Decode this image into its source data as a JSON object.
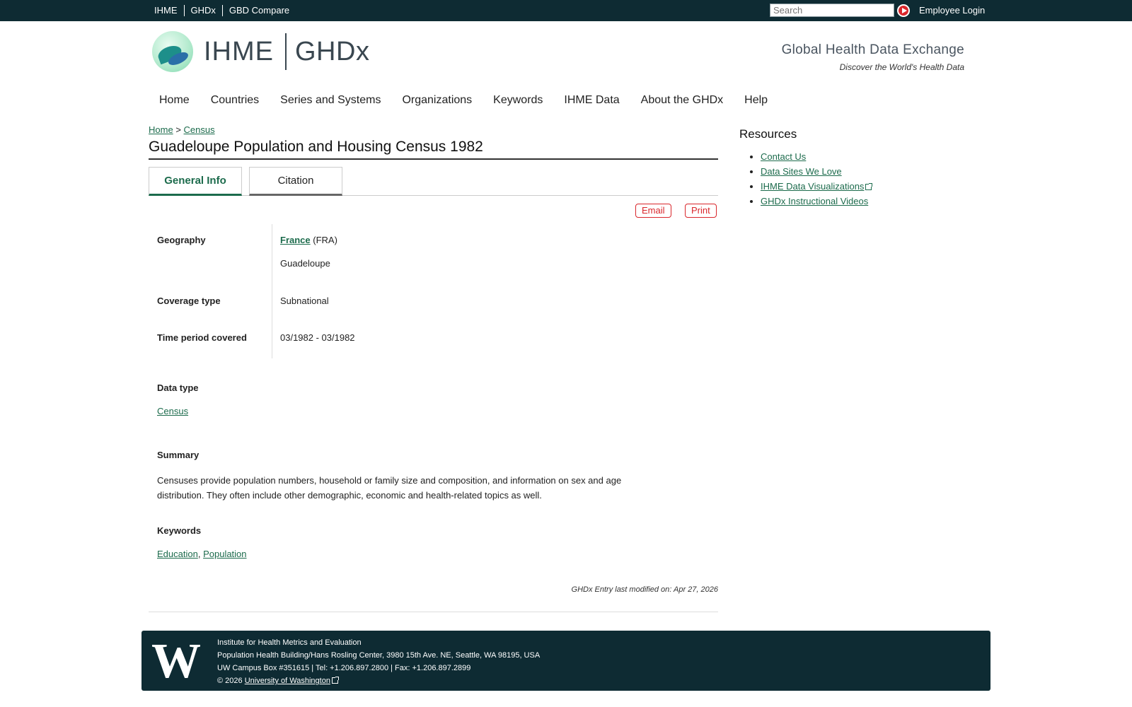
{
  "topbar": {
    "links": [
      "IHME",
      "GHDx",
      "GBD Compare"
    ],
    "search_placeholder": "Search",
    "employee_login": "Employee Login"
  },
  "header": {
    "brand_ihme": "IHME",
    "brand_ghdx": "GHDx",
    "tagline_title": "Global Health Data Exchange",
    "tagline_sub": "Discover the World's Health Data"
  },
  "nav": [
    "Home",
    "Countries",
    "Series and Systems",
    "Organizations",
    "Keywords",
    "IHME Data",
    "About the GHDx",
    "Help"
  ],
  "breadcrumb": {
    "home": "Home",
    "separator": ">",
    "current": "Census"
  },
  "page_title": "Guadeloupe Population and Housing Census 1982",
  "tabs": {
    "general": "General Info",
    "citation": "Citation"
  },
  "actions": {
    "email": "Email",
    "print": "Print"
  },
  "fields": {
    "geography_label": "Geography",
    "geography_country": "France",
    "geography_code": "(FRA)",
    "geography_sub": "Guadeloupe",
    "coverage_label": "Coverage type",
    "coverage_value": "Subnational",
    "time_label": "Time period covered",
    "time_value": "03/1982 - 03/1982",
    "datatype_label": "Data type",
    "datatype_value": "Census",
    "summary_label": "Summary",
    "summary_text": "Censuses provide population numbers, household or family size and composition, and information on sex and age distribution. They often include other demographic, economic and health-related topics as well.",
    "keywords_label": "Keywords",
    "keyword1": "Education",
    "keyword_sep": ",",
    "keyword2": "Population",
    "modified": "GHDx Entry last modified on: Apr 27, 2026"
  },
  "sidebar": {
    "title": "Resources",
    "items": [
      "Contact Us",
      "Data Sites We Love",
      "IHME Data Visualizations",
      "GHDx Instructional Videos"
    ]
  },
  "footer": {
    "logo": "W",
    "line1": "Institute for Health Metrics and Evaluation",
    "line2": "Population Health Building/Hans Rosling Center, 3980 15th Ave. NE, Seattle, WA 98195, USA",
    "line3": "UW Campus Box #351615 | Tel: +1.206.897.2800 | Fax: +1.206.897.2899",
    "copyright": "© 2026",
    "uw_link": "University of Washington"
  },
  "colors": {
    "topbar_bg": "#0e2b33",
    "link_green": "#1c6b4c",
    "action_red": "#d9262b"
  }
}
